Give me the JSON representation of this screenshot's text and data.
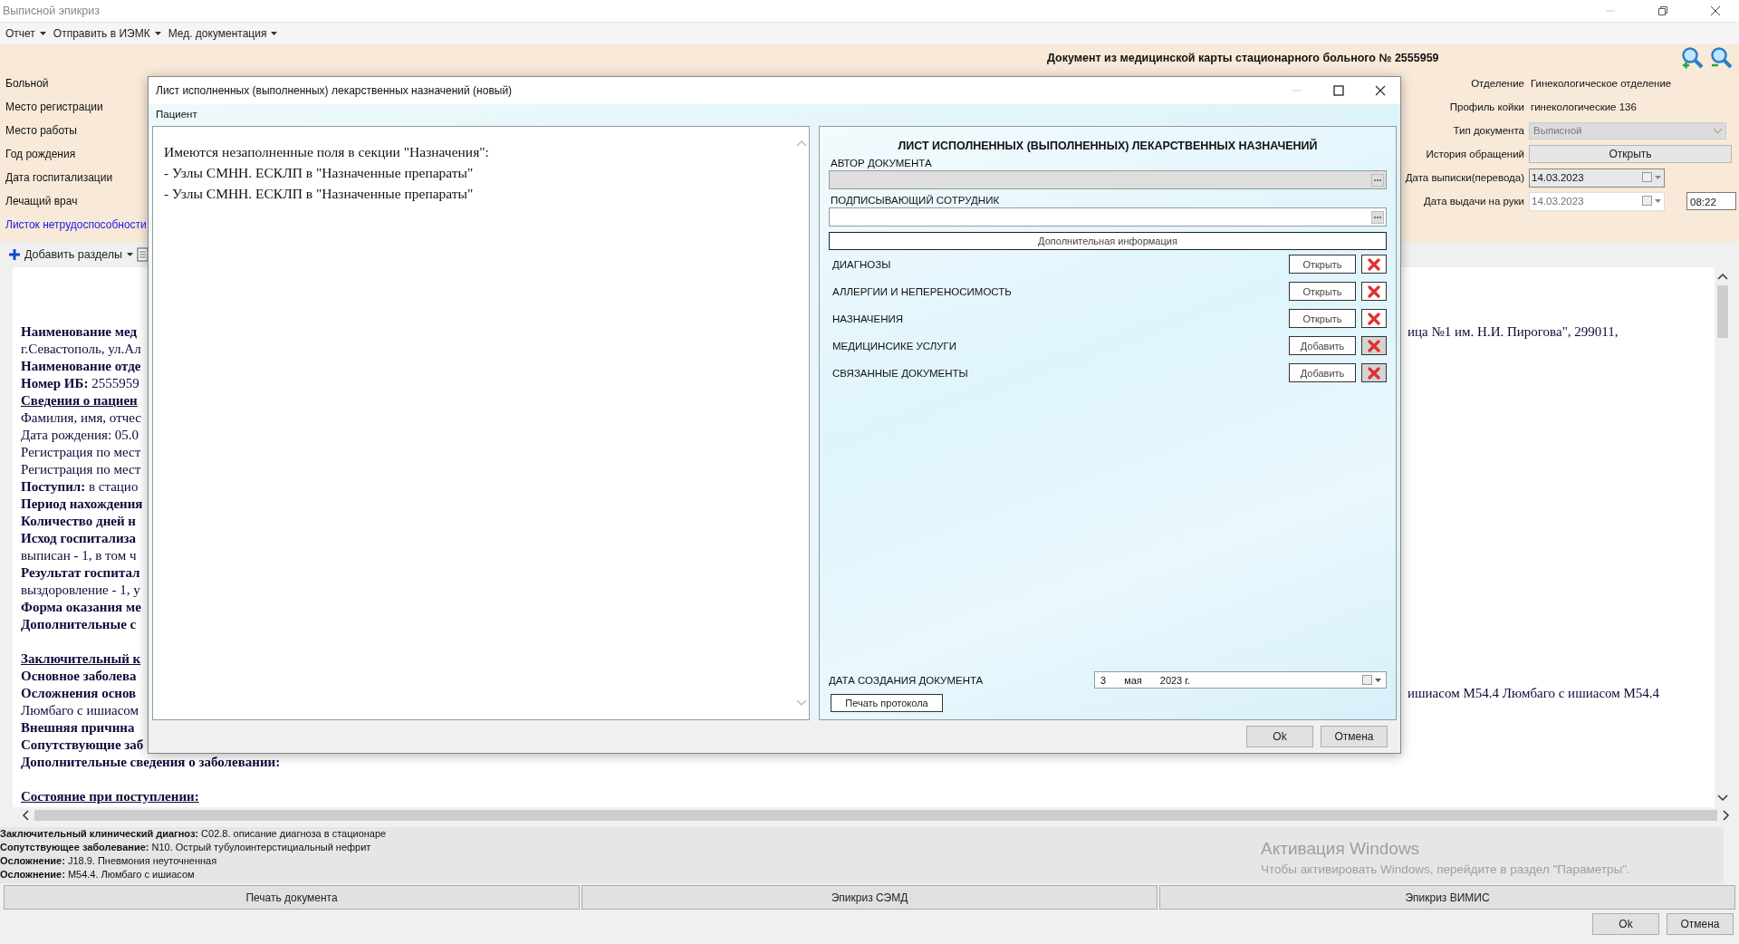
{
  "window": {
    "title": "Выписной эпикриз"
  },
  "menu": [
    {
      "label": "Отчет"
    },
    {
      "label": "Отправить в ИЭМК"
    },
    {
      "label": "Мед. документация"
    }
  ],
  "header": {
    "title": "Документ из медицинской карты стационарного больного №  2555959"
  },
  "patient_fields": [
    {
      "label": "Больной",
      "kind": "label"
    },
    {
      "label": "Место регистрации",
      "kind": "label"
    },
    {
      "label": "Место работы",
      "kind": "label"
    },
    {
      "label": "Год рождения",
      "kind": "label"
    },
    {
      "label": "Дата госпитализации",
      "kind": "label"
    },
    {
      "label": "Лечащий врач",
      "kind": "label"
    },
    {
      "label": "Листок нетрудоспособности",
      "kind": "link"
    }
  ],
  "info_fields": [
    {
      "label": "Отделение",
      "value": "Гинекологическое отделение",
      "kind": "text"
    },
    {
      "label": "Профиль койки",
      "value": "гинекологические 136",
      "kind": "text"
    },
    {
      "label": "Тип документа",
      "value": "Выписной",
      "kind": "combo",
      "disabled": true
    },
    {
      "label": "История обращений",
      "value": "Открыть",
      "kind": "button"
    },
    {
      "label": "Дата выписки(перевода)",
      "value": "14.03.2023",
      "kind": "date",
      "disabled": false
    },
    {
      "label": "Дата выдачи на руки",
      "value": "14.03.2023",
      "kind": "date",
      "disabled": true,
      "time": "08:22"
    }
  ],
  "toolbar": {
    "add_sections": "Добавить разделы"
  },
  "document": {
    "blocks": [
      {
        "lines": [
          {
            "kind": "bold",
            "text": "Наименование мед",
            "right": "ица №1 им. Н.И. Пирогова\", 299011,"
          },
          {
            "kind": "plain",
            "text": "г.Севастополь, ул.Ал"
          },
          {
            "kind": "bold",
            "text": "Наименование отде"
          },
          {
            "kind": "plain",
            "text": "**Номер ИБ:** 2555959"
          },
          {
            "kind": "heading",
            "text": "Сведения о пациен"
          },
          {
            "kind": "plain",
            "text": "Фамилия, имя, отчес"
          },
          {
            "kind": "plain",
            "text": "Дата рождения: 05.0"
          },
          {
            "kind": "plain",
            "text": "Регистрация по мест"
          },
          {
            "kind": "plain",
            "text": "Регистрация по мест"
          },
          {
            "kind": "plain",
            "text": "**Поступил:** в стацио"
          },
          {
            "kind": "bold",
            "text": "Период нахождения"
          },
          {
            "kind": "bold",
            "text": "Количество дней н"
          },
          {
            "kind": "bold",
            "text": "Исход госпитализа"
          },
          {
            "kind": "plain",
            "text": "выписан - 1, в том ч"
          },
          {
            "kind": "bold",
            "text": "Результат госпитал"
          },
          {
            "kind": "plain",
            "text": "выздоровление - 1, у"
          },
          {
            "kind": "bold",
            "text": "Форма оказания ме"
          },
          {
            "kind": "bold",
            "text": "Дополнительные с"
          }
        ]
      },
      {
        "lines": [
          {
            "kind": "heading",
            "text": "Заключительный к"
          },
          {
            "kind": "bold",
            "text": "Основное заболева"
          },
          {
            "kind": "bold",
            "text": "Осложнения основ",
            "right": "ишиасом M54.4 Люмбаго с ишиасом M54.4"
          },
          {
            "kind": "plain",
            "text": "Люмбаго с ишиасом"
          },
          {
            "kind": "bold",
            "text": "Внешняя причина"
          },
          {
            "kind": "bold",
            "text": "Сопутствующие заб"
          },
          {
            "kind": "bold",
            "text": "Дополнительные сведения о заболевании:"
          }
        ]
      },
      {
        "lines": [
          {
            "kind": "heading",
            "text": "Состояние при поступлении:"
          }
        ]
      }
    ]
  },
  "summary": [
    "**Заключительный клинический диагноз:** C02.8. описание диагноза в стационаре",
    "**Сопутствующее заболевание:** N10. Острый тубулоинтерстициальный нефрит",
    "**Осложнение:** J18.9. Пневмония неуточненная",
    "**Осложнение:** M54.4. Люмбаго с ишиасом"
  ],
  "actions": [
    "Печать документа",
    "Эпикриз СЭМД",
    "Эпикриз ВИМИС"
  ],
  "footer_buttons": [
    "Ok",
    "Отмена"
  ],
  "os_notice": {
    "title": "Активация Windows",
    "text": "Чтобы активировать Windows, перейдите в раздел \"Параметры\"."
  },
  "dialog": {
    "title": "Лист исполненных (выполненных) лекарственных назначений (новый)",
    "patient_label": "Пациент",
    "messages": [
      "Имеются незаполненные поля в секции \"Назначения\":",
      "- Узлы СМНН. ЕСКЛП в \"Назначенные препараты\"",
      "- Узлы СМНН. ЕСКЛП в \"Назначенные препараты\""
    ],
    "form_title": "ЛИСТ ИСПОЛНЕННЫХ (ВЫПОЛНЕННЫХ) ЛЕКАРСТВЕННЫХ НАЗНАЧЕНИЙ",
    "fields": [
      {
        "label": "АВТОР ДОКУМЕНТА",
        "disabled": true
      },
      {
        "label": "ПОДПИСЫВАЮЩИЙ СОТРУДНИК",
        "disabled": false
      }
    ],
    "extra_button": "Дополнительная информация",
    "sections": [
      {
        "label": "ДИАГНОЗЫ",
        "action": "Открыть",
        "delete_disabled": false
      },
      {
        "label": "АЛЛЕРГИИ И НЕПЕРЕНОСИМОСТЬ",
        "action": "Открыть",
        "delete_disabled": false
      },
      {
        "label": "НАЗНАЧЕНИЯ",
        "action": "Открыть",
        "delete_disabled": false
      },
      {
        "label": "МЕДИЦИНСИКЕ УСЛУГИ",
        "action": "Добавить",
        "delete_disabled": true
      },
      {
        "label": "СВЯЗАННЫЕ ДОКУМЕНТЫ",
        "action": "Добавить",
        "delete_disabled": true
      }
    ],
    "date_label": "ДАТА СОЗДАНИЯ ДОКУМЕНТА",
    "date_parts": [
      "3",
      "мая",
      "2023 г."
    ],
    "print_button": "Печать протокола",
    "buttons": [
      "Ok",
      "Отмена"
    ]
  }
}
